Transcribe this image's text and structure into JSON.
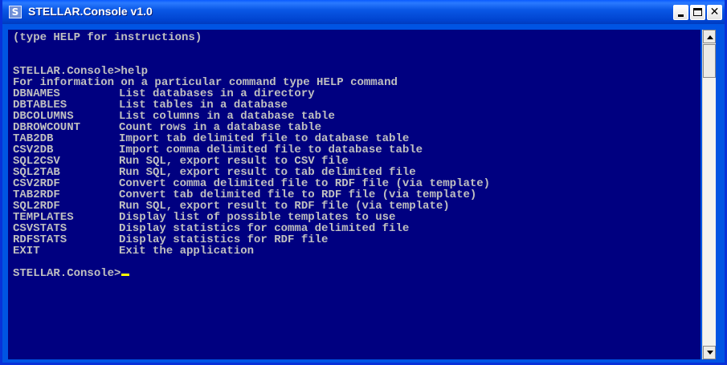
{
  "window": {
    "title": "STELLAR.Console v1.0",
    "icon_letter": "S"
  },
  "console": {
    "lines_top": [
      "(type HELP for instructions)",
      "",
      "STELLAR.Console>help",
      "For information on a particular command type HELP command"
    ],
    "commands": [
      {
        "name": "DBNAMES",
        "description": "List databases in a directory"
      },
      {
        "name": "DBTABLES",
        "description": "List tables in a database"
      },
      {
        "name": "DBCOLUMNS",
        "description": "List columns in a database table"
      },
      {
        "name": "DBROWCOUNT",
        "description": "Count rows in a database table"
      },
      {
        "name": "TAB2DB",
        "description": "Import tab delimited file to database table"
      },
      {
        "name": "CSV2DB",
        "description": "Import comma delimited file to database table"
      },
      {
        "name": "SQL2CSV",
        "description": "Run SQL, export result to CSV file"
      },
      {
        "name": "SQL2TAB",
        "description": "Run SQL, export result to tab delimited file"
      },
      {
        "name": "CSV2RDF",
        "description": "Convert comma delimited file to RDF file (via template)"
      },
      {
        "name": "TAB2RDF",
        "description": "Convert tab delimited file to RDF file (via template)"
      },
      {
        "name": "SQL2RDF",
        "description": "Run SQL, export result to RDF file (via template)"
      },
      {
        "name": "TEMPLATES",
        "description": "Display list of possible templates to use"
      },
      {
        "name": "CSVSTATS",
        "description": "Display statistics for comma delimited file"
      },
      {
        "name": "RDFSTATS",
        "description": "Display statistics for RDF file"
      },
      {
        "name": "EXIT",
        "description": "Exit the application"
      }
    ],
    "prompt": "STELLAR.Console>"
  },
  "colors": {
    "console_background": "#000080",
    "console_text": "#c0c0c0",
    "cursor": "#ffff00",
    "titlebar": "#0054e3"
  },
  "icons": {
    "app": "stellar-app-icon",
    "minimize": "minimize-icon",
    "maximize": "maximize-icon",
    "close": "close-icon",
    "scroll_up": "arrow-up-icon",
    "scroll_down": "arrow-down-icon"
  }
}
